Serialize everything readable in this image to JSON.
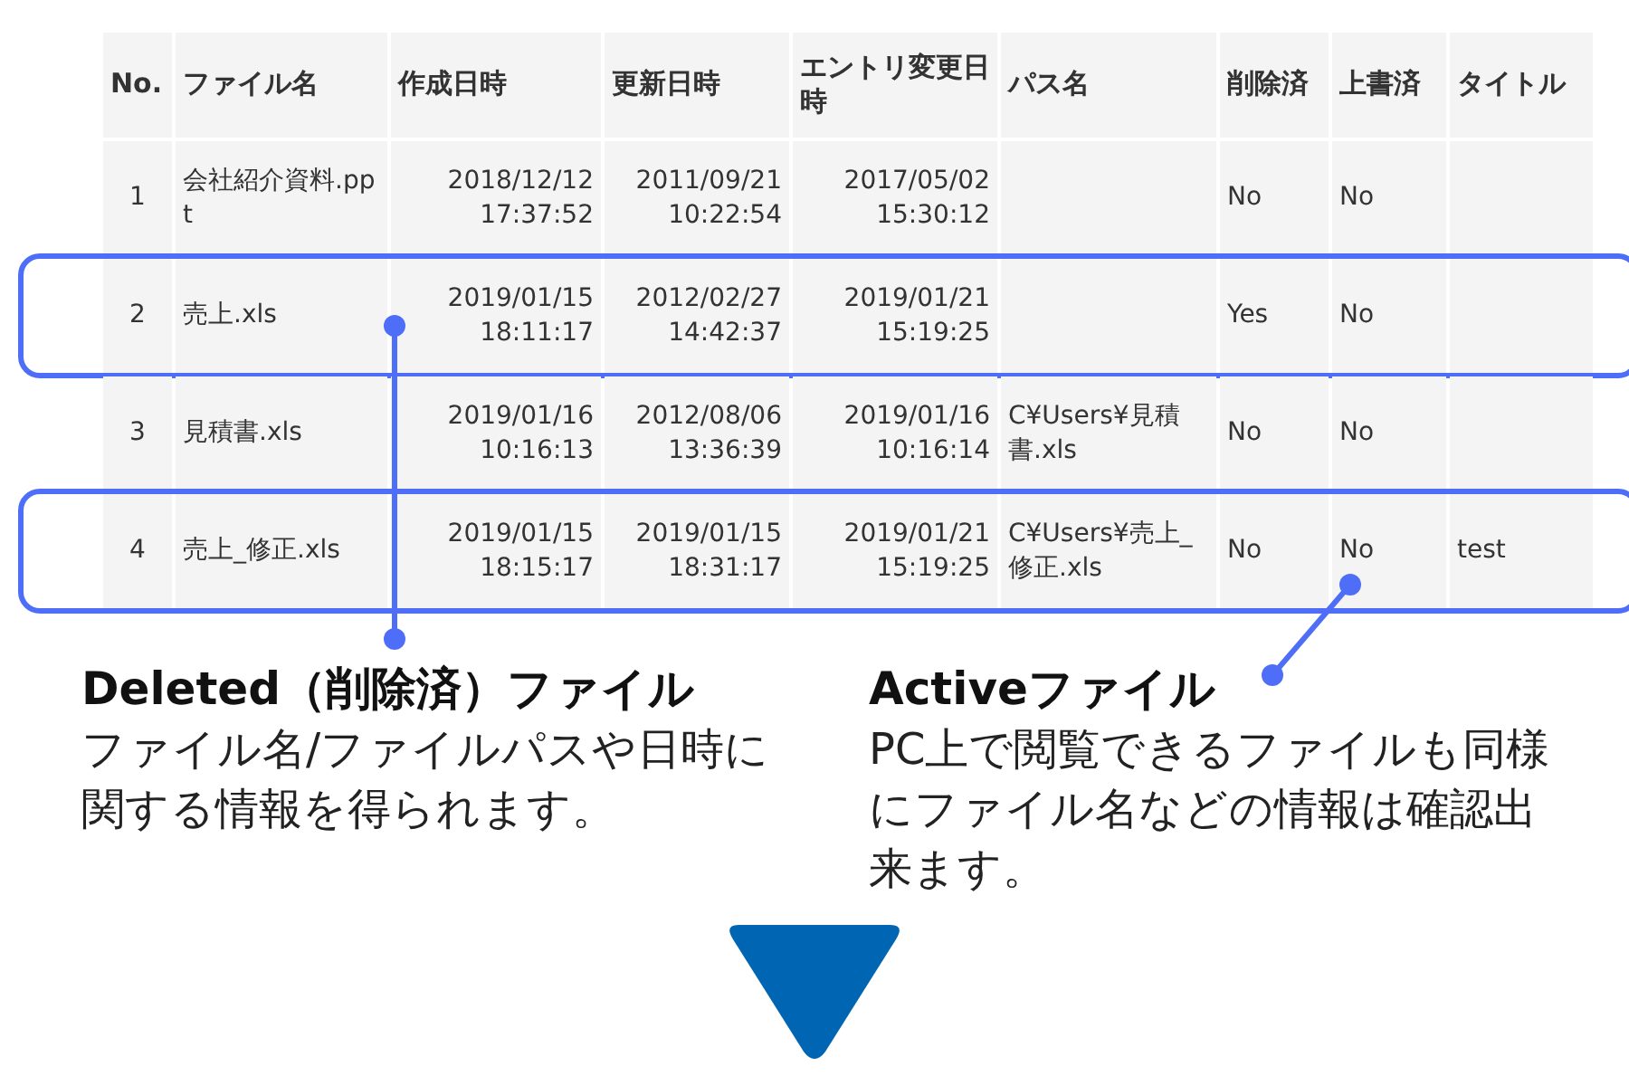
{
  "table": {
    "columns": [
      "No.",
      "ファイル名",
      "作成日時",
      "更新日時",
      "エントリ変更日時",
      "パス名",
      "削除済",
      "上書済",
      "タイトル"
    ],
    "rows": [
      {
        "highlighted": false,
        "cells": [
          "1",
          "会社紹介資料.ppt",
          "2018/12/12 17:37:52",
          "2011/09/21 10:22:54",
          "2017/05/02 15:30:12",
          null,
          "No",
          "No",
          null
        ]
      },
      {
        "highlighted": true,
        "cells": [
          "2",
          "売上.xls",
          "2019/01/15 18:11:17",
          "2012/02/27 14:42:37",
          "2019/01/21 15:19:25",
          null,
          "Yes",
          "No",
          null
        ]
      },
      {
        "highlighted": false,
        "cells": [
          "3",
          "見積書.xls",
          "2019/01/16 10:16:13",
          "2012/08/06 13:36:39",
          "2019/01/16 10:16:14",
          "C¥Users¥見積書.xls",
          "No",
          "No",
          null
        ]
      },
      {
        "highlighted": true,
        "cells": [
          "4",
          "売上_修正.xls",
          "2019/01/15 18:15:17",
          "2019/01/15 18:31:17",
          "2019/01/21 15:19:25",
          "C¥Users¥売上_修正.xls",
          "No",
          "No",
          "test"
        ]
      }
    ]
  },
  "callouts": [
    {
      "title": "Deleted（削除済）ファイル",
      "text": "ファイル名/ファイルパスや日時に関する情報を得られます。"
    },
    {
      "title": "Activeファイル",
      "text": "PC上で閲覧できるファイルも同様にファイル名などの情報は確認出来ます。"
    }
  ]
}
